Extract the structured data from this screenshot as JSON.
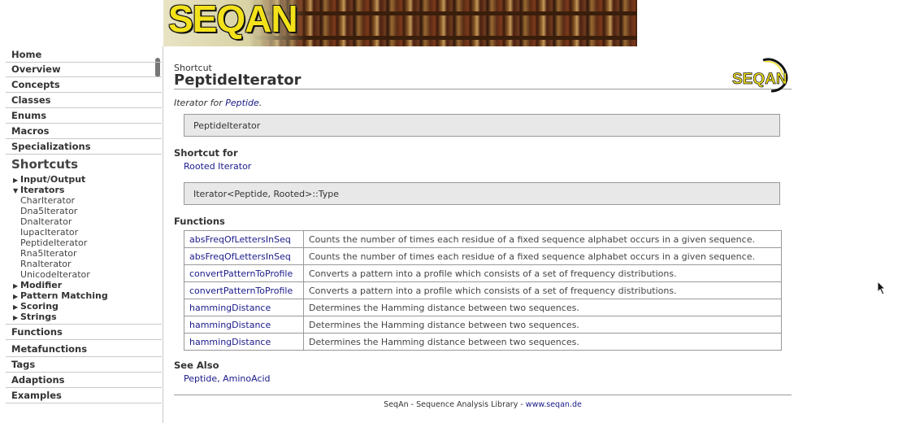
{
  "banner": {
    "logo_text": "SEQAN"
  },
  "sidebar": {
    "nav_top": [
      "Home",
      "Overview",
      "Concepts",
      "Classes",
      "Enums",
      "Macros",
      "Specializations"
    ],
    "shortcuts_title": "Shortcuts",
    "tree": {
      "input_output": "Input/Output",
      "iterators": "Iterators",
      "iterator_children": [
        "CharIterator",
        "Dna5Iterator",
        "DnaIterator",
        "IupacIterator",
        "PeptideIterator",
        "Rna5Iterator",
        "RnaIterator",
        "UnicodeIterator"
      ],
      "modifier": "Modifier",
      "pattern_matching": "Pattern Matching",
      "scoring": "Scoring",
      "strings": "Strings"
    },
    "nav_bottom": [
      "Functions",
      "Metafunctions",
      "Tags",
      "Adaptions",
      "Examples"
    ]
  },
  "page": {
    "kind": "Shortcut",
    "title": "PeptideIterator",
    "corner_logo_text": "SEQAN",
    "summary_prefix": "Iterator for ",
    "summary_link": "Peptide",
    "summary_suffix": ".",
    "signature": "PeptideIterator",
    "shortcut_for_heading": "Shortcut for",
    "shortcut_for_link": "Rooted Iterator",
    "shortcut_type": "Iterator<Peptide, Rooted>::Type",
    "functions_heading": "Functions",
    "functions": [
      {
        "name": "absFreqOfLettersInSeq",
        "desc": "Counts the number of times each residue of a fixed sequence alphabet occurs in a given sequence."
      },
      {
        "name": "absFreqOfLettersInSeq",
        "desc": "Counts the number of times each residue of a fixed sequence alphabet occurs in a given sequence."
      },
      {
        "name": "convertPatternToProfile",
        "desc": "Converts a pattern into a profile which consists of a set of frequency distributions."
      },
      {
        "name": "convertPatternToProfile",
        "desc": "Converts a pattern into a profile which consists of a set of frequency distributions."
      },
      {
        "name": "hammingDistance",
        "desc": "Determines the Hamming distance between two sequences."
      },
      {
        "name": "hammingDistance",
        "desc": "Determines the Hamming distance between two sequences."
      },
      {
        "name": "hammingDistance",
        "desc": "Determines the Hamming distance between two sequences."
      }
    ],
    "see_also_heading": "See Also",
    "see_also_links": [
      "Peptide",
      "AminoAcid"
    ],
    "see_also_sep": ", ",
    "footer_text": "SeqAn - Sequence Analysis Library - ",
    "footer_link": "www.seqan.de"
  },
  "colors": {
    "link": "#1a1a8a",
    "logo_yellow": "#f3e21a",
    "box_bg": "#e8e8e8"
  }
}
